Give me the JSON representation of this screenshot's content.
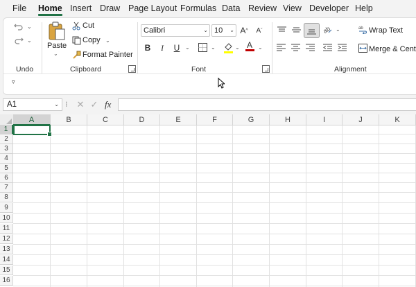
{
  "menu": {
    "tabs": [
      {
        "label": "File",
        "active": false
      },
      {
        "label": "Home",
        "active": true
      },
      {
        "label": "Insert",
        "active": false
      },
      {
        "label": "Draw",
        "active": false
      },
      {
        "label": "Page Layout",
        "active": false
      },
      {
        "label": "Formulas",
        "active": false
      },
      {
        "label": "Data",
        "active": false
      },
      {
        "label": "Review",
        "active": false
      },
      {
        "label": "View",
        "active": false
      },
      {
        "label": "Developer",
        "active": false
      },
      {
        "label": "Help",
        "active": false
      }
    ]
  },
  "ribbon": {
    "undo": {
      "group_label": "Undo"
    },
    "clipboard": {
      "group_label": "Clipboard",
      "paste_label": "Paste",
      "cut_label": "Cut",
      "copy_label": "Copy",
      "format_painter_label": "Format Painter"
    },
    "font": {
      "group_label": "Font",
      "font_name": "Calibri",
      "font_size": "10",
      "bold": "B",
      "italic": "I",
      "underline": "U",
      "font_color_letter": "A"
    },
    "alignment": {
      "group_label": "Alignment",
      "wrap_text_label": "Wrap Text",
      "merge_center_label": "Merge & Center"
    }
  },
  "formula_bar": {
    "name_box": "A1",
    "fx_label": "fx",
    "formula_value": ""
  },
  "sheet": {
    "columns": [
      "A",
      "B",
      "C",
      "D",
      "E",
      "F",
      "G",
      "H",
      "I",
      "J",
      "K"
    ],
    "rows": [
      "1",
      "2",
      "3",
      "4",
      "5",
      "6",
      "7",
      "8",
      "9",
      "10",
      "11",
      "12",
      "13",
      "14",
      "15",
      "16"
    ],
    "selected_cell": "A1"
  },
  "colors": {
    "accent": "#217346",
    "ribbon_bg": "#ffffff",
    "app_bg": "#f3f3f3"
  }
}
